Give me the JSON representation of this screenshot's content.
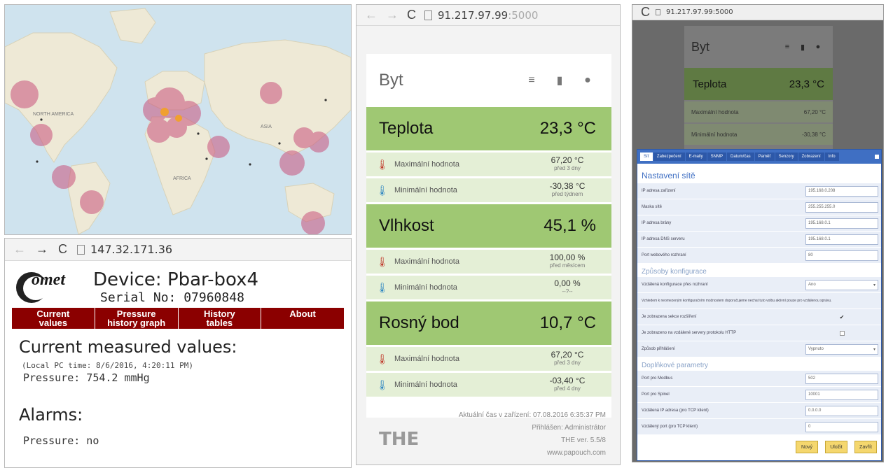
{
  "map": {
    "labels": {
      "north_america": "NORTH\nAMERICA",
      "asia": "ASIA",
      "africa": "AFRICA"
    },
    "colors": {
      "ocean": "#cfe3ee",
      "land": "#eee9d6",
      "cluster": "#c8527c"
    }
  },
  "comet": {
    "nav": {
      "back": "←",
      "forward": "→",
      "reload": "C",
      "url": "147.32.171.36"
    },
    "logo": "omet",
    "device_title": "Device: Pbar-box4",
    "serial": "Serial No: 07960848",
    "menu": [
      "Current\nvalues",
      "Pressure\nhistory graph",
      "History\ntables",
      "About"
    ],
    "current_heading": "Current measured values:",
    "local_time": "(Local PC time: 8/6/2016, 4:20:11 PM)",
    "pressure": "Pressure: 754.2 mmHg",
    "alarms_heading": "Alarms:",
    "alarm_pressure": "Pressure: no",
    "colors": {
      "menu_bg": "#8b0000"
    }
  },
  "mid": {
    "nav": {
      "back": "←",
      "forward": "→",
      "reload": "C",
      "url_host": "91.217.97.99",
      "url_port": ":5000"
    },
    "title": "Byt",
    "icons": {
      "menu": "≡",
      "device": "▮",
      "search": "●"
    },
    "sections": [
      {
        "label": "Teplota",
        "value": "23,3 °C",
        "rows": [
          {
            "icon": "thermometer-red-icon",
            "label": "Maximální hodnota",
            "value": "67,20 °C",
            "note": "před 3 dny"
          },
          {
            "icon": "thermometer-blue-icon",
            "label": "Minimální hodnota",
            "value": "-30,38 °C",
            "note": "před týdnem"
          }
        ]
      },
      {
        "label": "Vlhkost",
        "value": "45,1 %",
        "rows": [
          {
            "icon": "thermometer-red-icon",
            "label": "Maximální hodnota",
            "value": "100,00 %",
            "note": "před měsícem"
          },
          {
            "icon": "thermometer-blue-icon",
            "label": "Minimální hodnota",
            "value": "0,00 %",
            "note": "--?--"
          }
        ]
      },
      {
        "label": "Rosný bod",
        "value": "10,7 °C",
        "rows": [
          {
            "icon": "thermometer-red-icon",
            "label": "Maximální hodnota",
            "value": "67,20 °C",
            "note": "před 3 dny"
          },
          {
            "icon": "thermometer-blue-icon",
            "label": "Minimální hodnota",
            "value": "-03,40 °C",
            "note": "před 4 dny"
          }
        ]
      }
    ],
    "footer": {
      "logo": "THE",
      "time": "Aktuální čas v zařízení: 07.08.2016 6:35:37 PM",
      "login": "Přihlášen: Administrátor",
      "version": "THE ver. 5.5/8",
      "site": "www.papouch.com"
    },
    "colors": {
      "section": "#9fc873",
      "row": "#e4efd6"
    }
  },
  "right": {
    "nav": {
      "reload": "C",
      "url": "91.217.97.99:5000"
    },
    "ghost": {
      "title": "Byt",
      "section": "Teplota",
      "value": "23,3 °C",
      "row1_label": "Maximální hodnota",
      "row1_value": "67,20 °C",
      "row2_label": "Minimální hodnota",
      "row2_value": "-30,38 °C"
    },
    "tabs": [
      "Síť",
      "Zabezpečení",
      "E-maily",
      "SNMP",
      "Datum/čas",
      "Paměť",
      "Senzory",
      "Zobrazení",
      "Info"
    ],
    "heading": "Nastavení sítě",
    "network_rows": [
      {
        "label": "IP adresa zařízení",
        "value": "195.168.0.208"
      },
      {
        "label": "Maska sítě",
        "value": "255.255.255.0"
      },
      {
        "label": "IP adresa brány",
        "value": "195.168.0.1"
      },
      {
        "label": "IP adresa DNS serveru",
        "value": "195.168.0.1"
      },
      {
        "label": "Port webového rozhraní",
        "value": "80"
      }
    ],
    "config_heading": "Způsoby konfigurace",
    "config_select": {
      "label": "Vzdálená konfigurace přes rozhraní",
      "value": "Ano"
    },
    "config_note": "Vzhledem k neomezeným konfiguračním možnostem doporučujeme nechat tuto volbu aktivní pouze pro vzdálenou správu.",
    "config_checks": [
      {
        "label": "Je zobrazena sekce rozšíření",
        "checked": "✔"
      },
      {
        "label": "Je zobrazeno na vzdálené servery protokolu HTTP",
        "checked": ""
      }
    ],
    "protocol_select": {
      "label": "Způsob přihlášení",
      "value": "Vypnuto"
    },
    "extra_heading": "Doplňkové parametry",
    "extra_rows": [
      {
        "label": "Port pro Modbus",
        "value": "502"
      },
      {
        "label": "Port pro Spinel",
        "value": "10001"
      },
      {
        "label": "Vzdálená IP adresa (pro TCP klient)",
        "value": "0.0.0.0"
      },
      {
        "label": "Vzdálený port (pro TCP klient)",
        "value": "0"
      }
    ],
    "buttons": [
      "Nový",
      "Uložit",
      "Zavřít"
    ],
    "colors": {
      "tabbar": "#3f6fc3",
      "button": "#f5d76e"
    }
  }
}
